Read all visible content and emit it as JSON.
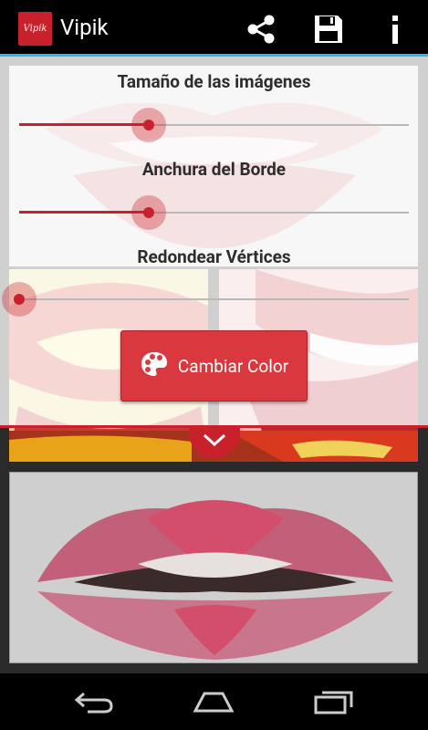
{
  "app": {
    "title": "Vipik",
    "logo_text": "Vipik"
  },
  "actionbar": {
    "share_icon": "share-icon",
    "save_icon": "save-icon",
    "info_icon": "info-icon"
  },
  "settings": {
    "image_size": {
      "label": "Tamaño de las imágenes",
      "value": 0.33
    },
    "border_width": {
      "label": "Anchura del Borde",
      "value": 0.33
    },
    "round_corners": {
      "label": "Redondear Vértices",
      "value": 0.0
    }
  },
  "color_button": {
    "label": "Cambiar Color",
    "icon": "palette-icon"
  },
  "collapse": {
    "icon": "chevron-down-icon"
  },
  "navbar": {
    "back_icon": "back-icon",
    "home_icon": "home-icon",
    "recent_icon": "recent-apps-icon"
  },
  "colors": {
    "accent": "#c9212b",
    "holo_blue": "#33b5e5"
  }
}
